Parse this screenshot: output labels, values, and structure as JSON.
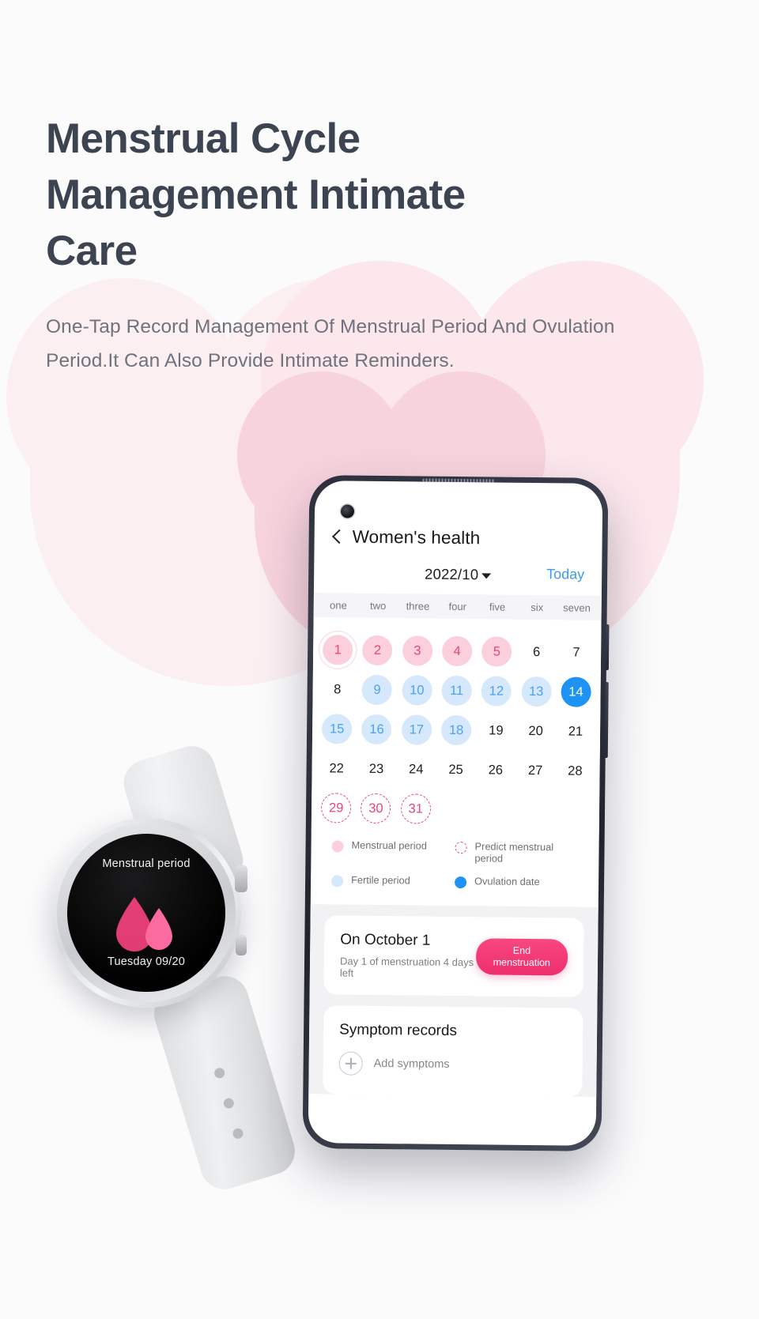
{
  "hero": {
    "headline": "Menstrual Cycle Management Intimate Care",
    "subline": "One-Tap Record Management Of Menstrual Period And Ovulation Period.It Can Also Provide Intimate Reminders.",
    "headline_color": "#3d4451",
    "subline_color": "#6f737c"
  },
  "watch": {
    "title": "Menstrual period",
    "date": "Tuesday 09/20",
    "drop_color": "#f4417d"
  },
  "phone": {
    "nav": {
      "back_icon": "chevron-left-icon",
      "title": "Women's health"
    },
    "month_bar": {
      "month": "2022/10",
      "caret_icon": "caret-down-icon",
      "today": "Today",
      "today_color": "#3b9bf0"
    },
    "weekdays": [
      "one",
      "two",
      "three",
      "four",
      "five",
      "six",
      "seven"
    ],
    "calendar": {
      "days": [
        {
          "n": "1",
          "state": "menstrual-first"
        },
        {
          "n": "2",
          "state": "menstrual"
        },
        {
          "n": "3",
          "state": "menstrual"
        },
        {
          "n": "4",
          "state": "menstrual"
        },
        {
          "n": "5",
          "state": "menstrual"
        },
        {
          "n": "6",
          "state": "plain"
        },
        {
          "n": "7",
          "state": "plain"
        },
        {
          "n": "8",
          "state": "plain"
        },
        {
          "n": "9",
          "state": "fertile"
        },
        {
          "n": "10",
          "state": "fertile"
        },
        {
          "n": "11",
          "state": "fertile"
        },
        {
          "n": "12",
          "state": "fertile"
        },
        {
          "n": "13",
          "state": "fertile"
        },
        {
          "n": "14",
          "state": "ovulation"
        },
        {
          "n": "15",
          "state": "fertile"
        },
        {
          "n": "16",
          "state": "fertile"
        },
        {
          "n": "17",
          "state": "fertile"
        },
        {
          "n": "18",
          "state": "fertile"
        },
        {
          "n": "19",
          "state": "plain"
        },
        {
          "n": "20",
          "state": "plain"
        },
        {
          "n": "21",
          "state": "plain"
        },
        {
          "n": "22",
          "state": "plain"
        },
        {
          "n": "23",
          "state": "plain"
        },
        {
          "n": "24",
          "state": "plain"
        },
        {
          "n": "25",
          "state": "plain"
        },
        {
          "n": "26",
          "state": "plain"
        },
        {
          "n": "27",
          "state": "plain"
        },
        {
          "n": "28",
          "state": "plain"
        },
        {
          "n": "29",
          "state": "predict"
        },
        {
          "n": "30",
          "state": "predict"
        },
        {
          "n": "31",
          "state": "predict"
        }
      ]
    },
    "legend": [
      {
        "key": "menstrual",
        "label": "Menstrual period",
        "color": "#fbcfdb"
      },
      {
        "key": "predict",
        "label": "Predict menstrual period",
        "color": "#e8467f"
      },
      {
        "key": "fertile",
        "label": "Fertile period",
        "color": "#d6e8fb"
      },
      {
        "key": "ovulation",
        "label": "Ovulation date",
        "color": "#1e92f5"
      }
    ],
    "status_card": {
      "title": "On October 1",
      "subtitle": "Day 1 of menstruation 4 days left",
      "button": "End menstruation",
      "button_color": "#ee2f6e"
    },
    "symptom_card": {
      "title": "Symptom records",
      "add_icon": "plus-circle-icon",
      "add_label": "Add symptoms"
    }
  }
}
